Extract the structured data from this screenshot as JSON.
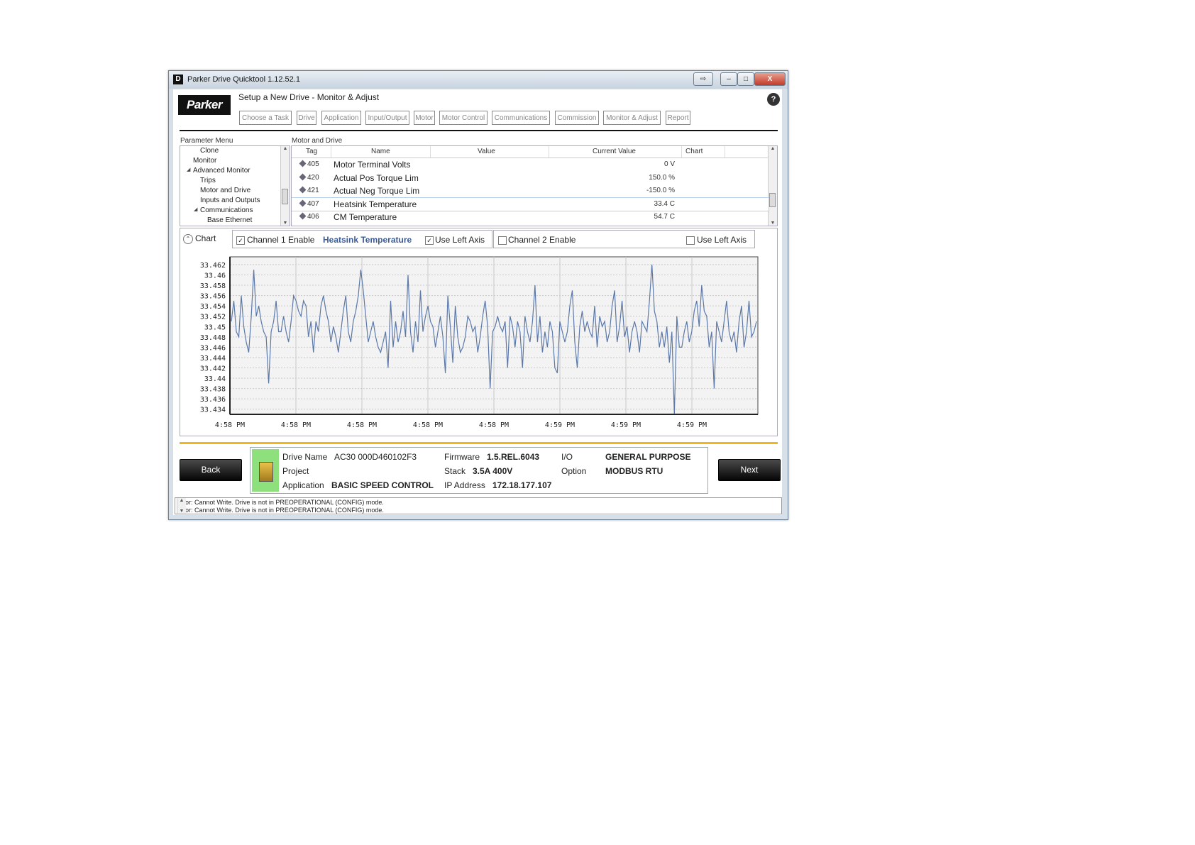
{
  "window": {
    "title": "Parker Drive Quicktool 1.12.52.1",
    "controls": {
      "restore": "⇨",
      "minimize": "–",
      "maximize": "□",
      "close": "X"
    }
  },
  "header": {
    "logo": "Parker",
    "page_title": "Setup a New Drive - Monitor & Adjust",
    "help": "?",
    "tabs": [
      {
        "label": "Choose a Task",
        "active": true
      },
      {
        "label": "Drive",
        "active": false
      },
      {
        "label": "Application",
        "active": false
      },
      {
        "label": "Input/Output",
        "active": false
      },
      {
        "label": "Motor",
        "active": false
      },
      {
        "label": "Motor Control",
        "active": false
      },
      {
        "label": "Communications",
        "active": false
      },
      {
        "label": "Commission",
        "active": true
      },
      {
        "label": "Monitor & Adjust",
        "active": false
      },
      {
        "label": "Report",
        "active": true
      }
    ]
  },
  "parameter_menu": {
    "label": "Parameter Menu",
    "items": [
      {
        "label": "Clone",
        "indent": 2,
        "expander": ""
      },
      {
        "label": "Monitor",
        "indent": 1,
        "expander": ""
      },
      {
        "label": "Advanced Monitor",
        "indent": 1,
        "expander": "◢"
      },
      {
        "label": "Trips",
        "indent": 2,
        "expander": ""
      },
      {
        "label": "Motor and Drive",
        "indent": 2,
        "expander": "",
        "selected": true
      },
      {
        "label": "Inputs and Outputs",
        "indent": 2,
        "expander": ""
      },
      {
        "label": "Communications",
        "indent": 2,
        "expander": "◢"
      },
      {
        "label": "Base Ethernet",
        "indent": 3,
        "expander": ""
      }
    ]
  },
  "parameters": {
    "label": "Motor and Drive",
    "columns": {
      "tag": "Tag",
      "name": "Name",
      "value": "Value",
      "current_value": "Current Value",
      "chart": "Chart"
    },
    "rows": [
      {
        "tag": "405",
        "name": "Motor Terminal Volts",
        "current_value": "0 V"
      },
      {
        "tag": "420",
        "name": "Actual Pos Torque Lim",
        "current_value": "150.0 %"
      },
      {
        "tag": "421",
        "name": "Actual Neg Torque Lim",
        "current_value": "-150.0 %"
      },
      {
        "tag": "407",
        "name": "Heatsink Temperature",
        "current_value": "33.4 C",
        "selected": true
      },
      {
        "tag": "406",
        "name": "CM Temperature",
        "current_value": "54.7 C"
      }
    ]
  },
  "chart_panel": {
    "collapse_icon": "⌃",
    "label": "Chart",
    "channel1": {
      "enable_label": "Channel 1 Enable",
      "enabled": true,
      "parameter": "Heatsink Temperature",
      "left_axis_label": "Use Left Axis",
      "left_axis": true
    },
    "channel2": {
      "enable_label": "Channel 2 Enable",
      "enabled": false,
      "left_axis_label": "Use Left Axis",
      "left_axis": false
    },
    "line_color": "#5b78a8"
  },
  "chart_data": {
    "type": "line",
    "title": "",
    "xlabel": "",
    "ylabel": "",
    "ylim": [
      33.433,
      33.4635
    ],
    "yticks": [
      33.462,
      33.46,
      33.458,
      33.456,
      33.454,
      33.452,
      33.45,
      33.448,
      33.446,
      33.444,
      33.442,
      33.44,
      33.438,
      33.436,
      33.434
    ],
    "ytick_labels": [
      "33.462",
      "33.46",
      "33.458",
      "33.456",
      "33.454",
      "33.452",
      "33.45",
      "33.448",
      "33.446",
      "33.444",
      "33.442",
      "33.44",
      "33.438",
      "33.436",
      "33.434"
    ],
    "xtick_labels": [
      "4:58 PM",
      "4:58 PM",
      "4:58 PM",
      "4:58 PM",
      "4:58 PM",
      "4:59 PM",
      "4:59 PM",
      "4:59 PM"
    ],
    "grid": true,
    "series": [
      {
        "values": [
          33.451,
          33.455,
          33.449,
          33.448,
          33.456,
          33.45,
          33.447,
          33.445,
          33.452,
          33.461,
          33.452,
          33.454,
          33.451,
          33.449,
          33.448,
          33.439,
          33.449,
          33.451,
          33.455,
          33.449,
          33.449,
          33.452,
          33.449,
          33.447,
          33.451,
          33.456,
          33.455,
          33.453,
          33.452,
          33.455,
          33.454,
          33.448,
          33.451,
          33.445,
          33.451,
          33.449,
          33.454,
          33.456,
          33.453,
          33.451,
          33.447,
          33.45,
          33.448,
          33.445,
          33.449,
          33.453,
          33.456,
          33.449,
          33.447,
          33.451,
          33.453,
          33.456,
          33.461,
          33.457,
          33.452,
          33.447,
          33.449,
          33.451,
          33.448,
          33.446,
          33.445,
          33.447,
          33.449,
          33.442,
          33.455,
          33.446,
          33.451,
          33.447,
          33.449,
          33.453,
          33.448,
          33.46,
          33.449,
          33.445,
          33.451,
          33.447,
          33.457,
          33.449,
          33.452,
          33.454,
          33.451,
          33.45,
          33.446,
          33.449,
          33.452,
          33.448,
          33.441,
          33.456,
          33.45,
          33.443,
          33.454,
          33.448,
          33.445,
          33.446,
          33.448,
          33.452,
          33.451,
          33.449,
          33.45,
          33.445,
          33.448,
          33.452,
          33.455,
          33.45,
          33.438,
          33.449,
          33.45,
          33.452,
          33.45,
          33.449,
          33.451,
          33.442,
          33.452,
          33.45,
          33.446,
          33.451,
          33.449,
          33.442,
          33.452,
          33.449,
          33.447,
          33.451,
          33.458,
          33.447,
          33.452,
          33.445,
          33.449,
          33.446,
          33.451,
          33.449,
          33.442,
          33.441,
          33.451,
          33.449,
          33.447,
          33.449,
          33.454,
          33.457,
          33.447,
          33.442,
          33.45,
          33.453,
          33.449,
          33.451,
          33.449,
          33.448,
          33.454,
          33.446,
          33.452,
          33.45,
          33.451,
          33.447,
          33.449,
          33.454,
          33.457,
          33.447,
          33.45,
          33.455,
          33.448,
          33.45,
          33.445,
          33.449,
          33.451,
          33.449,
          33.445,
          33.451,
          33.45,
          33.449,
          33.455,
          33.462,
          33.453,
          33.451,
          33.446,
          33.449,
          33.446,
          33.45,
          33.443,
          33.449,
          33.433,
          33.452,
          33.446,
          33.446,
          33.449,
          33.451,
          33.447,
          33.449,
          33.453,
          33.455,
          33.45,
          33.458,
          33.453,
          33.452,
          33.446,
          33.449,
          33.438,
          33.451,
          33.449,
          33.447,
          33.451,
          33.455,
          33.449,
          33.447,
          33.449,
          33.445,
          33.451,
          33.454,
          33.446,
          33.449,
          33.455,
          33.448,
          33.449,
          33.451
        ]
      }
    ]
  },
  "footer": {
    "back": "Back",
    "next": "Next",
    "drive_name_label": "Drive Name",
    "drive_name": "AC30 000D460102F3",
    "project_label": "Project",
    "application_label": "Application",
    "application": "BASIC SPEED CONTROL",
    "firmware_label": "Firmware",
    "firmware": "1.5.REL.6043",
    "stack_label": "Stack",
    "stack": "3.5A 400V",
    "ip_label": "IP Address",
    "ip": "172.18.177.107",
    "io_label": "I/O",
    "io": "GENERAL PURPOSE",
    "option_label": "Option",
    "option": "MODBUS RTU"
  },
  "log": {
    "lines": [
      "Error: Cannot Write.  Drive is not in PREOPERATIONAL (CONFIG) mode.",
      "Error: Cannot Write.  Drive is not in PREOPERATIONAL (CONFIG) mode."
    ]
  }
}
